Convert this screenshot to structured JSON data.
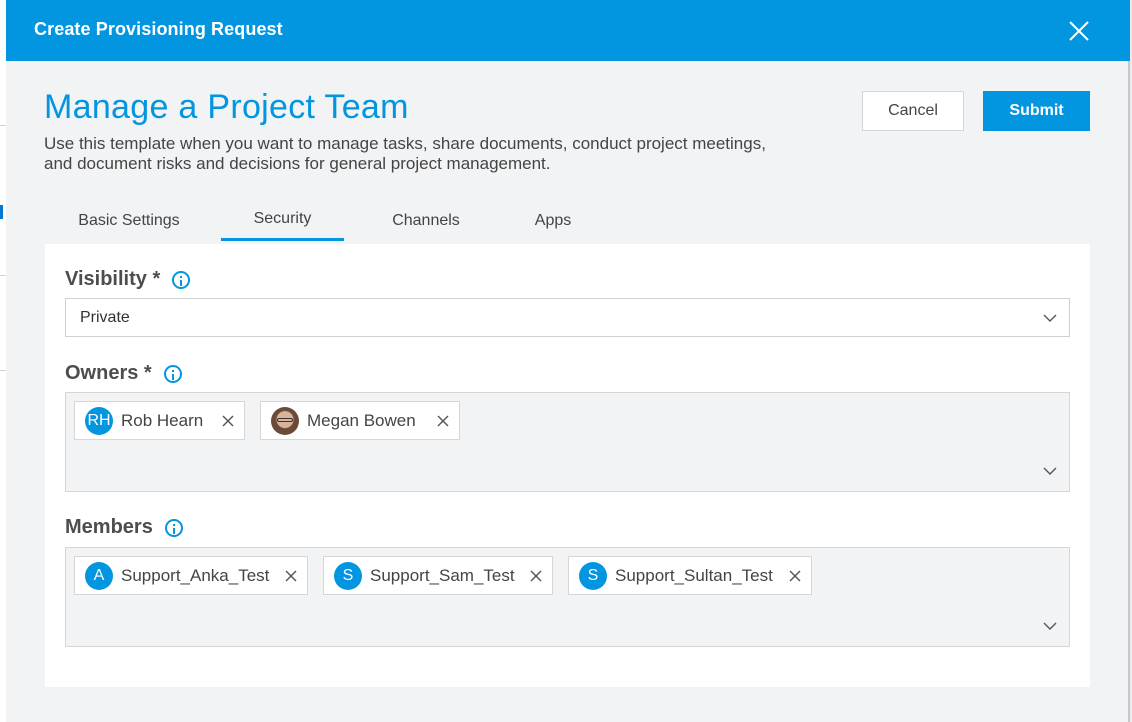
{
  "dialog": {
    "title": "Create Provisioning Request",
    "close_icon": "close-icon"
  },
  "template": {
    "heading": "Manage a Project Team",
    "description_lines": [
      "Use this template when you want to manage tasks, share documents, conduct project meetings,",
      "and document risks and decisions for general project management."
    ]
  },
  "actions": {
    "cancel_label": "Cancel",
    "submit_label": "Submit"
  },
  "tabs": [
    {
      "label": "Basic Settings",
      "active": false
    },
    {
      "label": "Security",
      "active": true
    },
    {
      "label": "Channels",
      "active": false
    },
    {
      "label": "Apps",
      "active": false
    }
  ],
  "security": {
    "visibility": {
      "label": "Visibility *",
      "value": "Private",
      "icon": "info-icon"
    },
    "owners": {
      "label": "Owners *",
      "icon": "info-icon",
      "people": [
        {
          "initials": "RH",
          "name": "Rob Hearn",
          "photo": false
        },
        {
          "initials": "",
          "name": "Megan Bowen",
          "photo": true
        }
      ]
    },
    "members": {
      "label": "Members",
      "icon": "info-icon",
      "people": [
        {
          "initials": "A",
          "name": "Support_Anka_Test",
          "photo": false
        },
        {
          "initials": "S",
          "name": "Support_Sam_Test",
          "photo": false
        },
        {
          "initials": "S",
          "name": "Support_Sultan_Test",
          "photo": false
        }
      ]
    }
  },
  "colors": {
    "accent": "#0396e0",
    "panel_bg": "#ffffff",
    "dialog_bg": "#f2f3f5"
  }
}
